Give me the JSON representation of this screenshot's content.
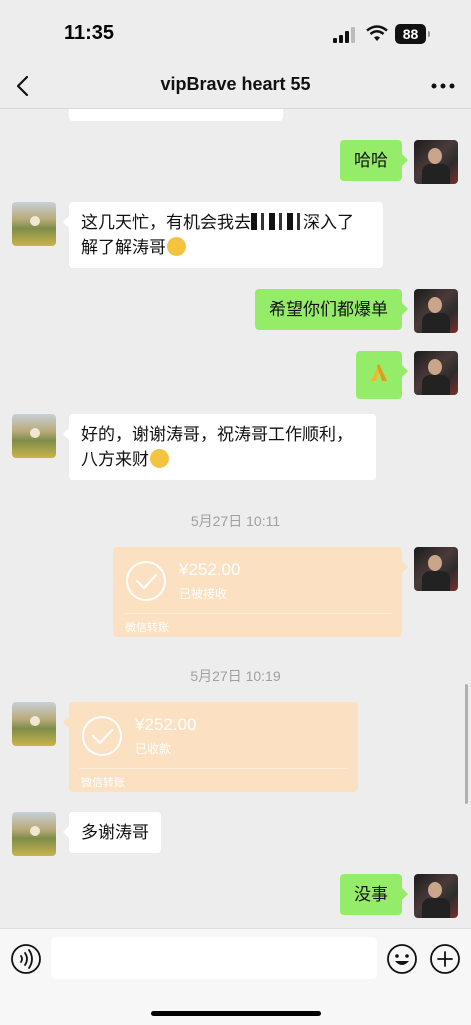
{
  "status_bar": {
    "time": "11:35",
    "battery": "88"
  },
  "nav": {
    "title": "vipBrave heart 55"
  },
  "chat": {
    "msg_haha": "哈哈",
    "msg_busy_1": "这几天忙，有机会我去",
    "msg_busy_2": "深入了",
    "msg_busy_3": "解了解涛哥",
    "msg_hope": "希望你们都爆单",
    "msg_thanks_line1": "好的，谢谢涛哥，祝涛哥工作顺利，",
    "msg_thanks_line2": "八方来财",
    "timestamp_1": "5月27日 10:11",
    "transfer_1": {
      "amount": "¥252.00",
      "status": "已被接收",
      "label": "微信转账"
    },
    "timestamp_2": "5月27日 10:19",
    "transfer_2": {
      "amount": "¥252.00",
      "status": "已收款",
      "label": "微信转账"
    },
    "msg_many_thanks": "多谢涛哥",
    "msg_no_problem": "没事"
  },
  "input_bar": {
    "placeholder": ""
  },
  "icons": [
    "back-icon",
    "more-icon",
    "voice-icon",
    "emoji-icon",
    "plus-icon",
    "check-icon",
    "hands-emoji-icon"
  ],
  "colors": {
    "sent_bubble": "#95ec69",
    "received_bubble": "#ffffff",
    "transfer": "#fbe0c1",
    "background": "#ededed"
  }
}
